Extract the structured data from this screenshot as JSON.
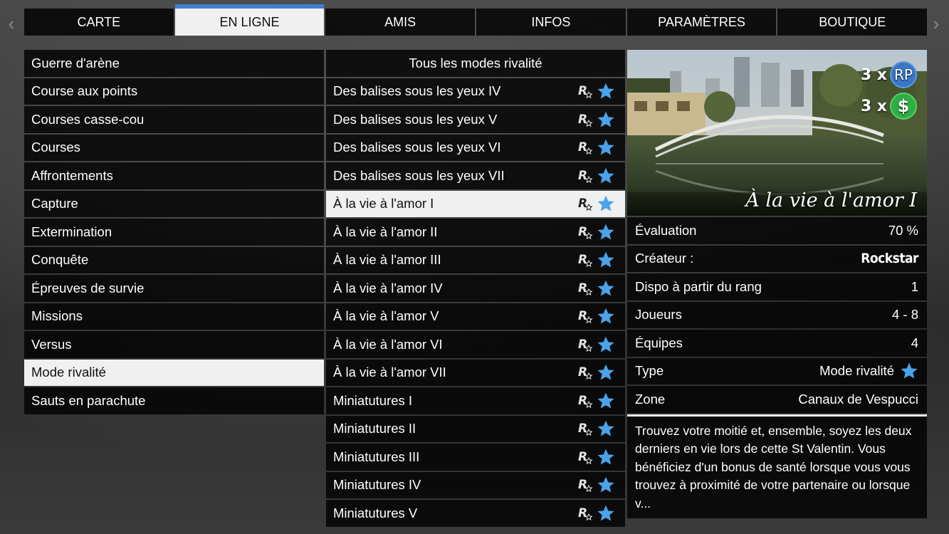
{
  "nav": {
    "prev_icon": "chevron-left-icon",
    "next_icon": "chevron-right-icon"
  },
  "tabs": [
    {
      "label": "CARTE"
    },
    {
      "label": "EN LIGNE"
    },
    {
      "label": "AMIS"
    },
    {
      "label": "INFOS"
    },
    {
      "label": "PARAMÈTRES"
    },
    {
      "label": "BOUTIQUE"
    }
  ],
  "active_tab": "EN LIGNE",
  "categories": [
    {
      "label": "Guerre d'arène"
    },
    {
      "label": "Course aux points"
    },
    {
      "label": "Courses casse-cou"
    },
    {
      "label": "Courses"
    },
    {
      "label": "Affrontements"
    },
    {
      "label": "Capture"
    },
    {
      "label": "Extermination"
    },
    {
      "label": "Conquête"
    },
    {
      "label": "Épreuves de survie"
    },
    {
      "label": "Missions"
    },
    {
      "label": "Versus"
    },
    {
      "label": "Mode rivalité"
    },
    {
      "label": "Sauts en parachute"
    }
  ],
  "selected_category": "Mode rivalité",
  "modes": {
    "header": "Tous les modes rivalité",
    "items": [
      {
        "label": "Des balises sous les yeux IV"
      },
      {
        "label": "Des balises sous les yeux V"
      },
      {
        "label": "Des balises sous les yeux VI"
      },
      {
        "label": "Des balises sous les yeux VII"
      },
      {
        "label": "À la vie à l'amor I"
      },
      {
        "label": "À la vie à l'amor II"
      },
      {
        "label": "À la vie à l'amor III"
      },
      {
        "label": "À la vie à l'amor IV"
      },
      {
        "label": "À la vie à l'amor V"
      },
      {
        "label": "À la vie à l'amor VI"
      },
      {
        "label": "À la vie à l'amor VII"
      },
      {
        "label": "Miniatutures I"
      },
      {
        "label": "Miniatutures II"
      },
      {
        "label": "Miniatutures III"
      },
      {
        "label": "Miniatutures IV"
      },
      {
        "label": "Miniatutures V"
      }
    ],
    "selected": "À la vie à l'amor I",
    "row_icons": [
      "rockstar-verified-icon",
      "star-icon"
    ],
    "star_color": "#4aa3ea"
  },
  "details": {
    "preview_title": "À la vie à l'amor I",
    "bonus_rp": {
      "multiplier": "3 x",
      "badge": "RP"
    },
    "bonus_cash": {
      "multiplier": "3 x",
      "badge": "$"
    },
    "rows": [
      {
        "label": "Évaluation",
        "value": "70 %"
      },
      {
        "label": "Créateur :",
        "value": "Rockstar"
      },
      {
        "label": "Dispo à partir du rang",
        "value": "1"
      },
      {
        "label": "Joueurs",
        "value": "4 - 8"
      },
      {
        "label": "Équipes",
        "value": "4"
      },
      {
        "label": "Type",
        "value": "Mode rivalité"
      },
      {
        "label": "Zone",
        "value": "Canaux de Vespucci"
      }
    ],
    "description": "Trouvez votre moitié et, ensemble, soyez les deux derniers en vie lors de cette St Valentin. Vous bénéficiez d'un bonus de santé lorsque vous vous trouvez à proximité de votre partenaire ou lorsque v..."
  },
  "colors": {
    "accent": "#3f7fd0",
    "rp_badge": "#3a78c7",
    "cash_badge": "#2fae43",
    "selected_row": "#f0f0f0"
  }
}
